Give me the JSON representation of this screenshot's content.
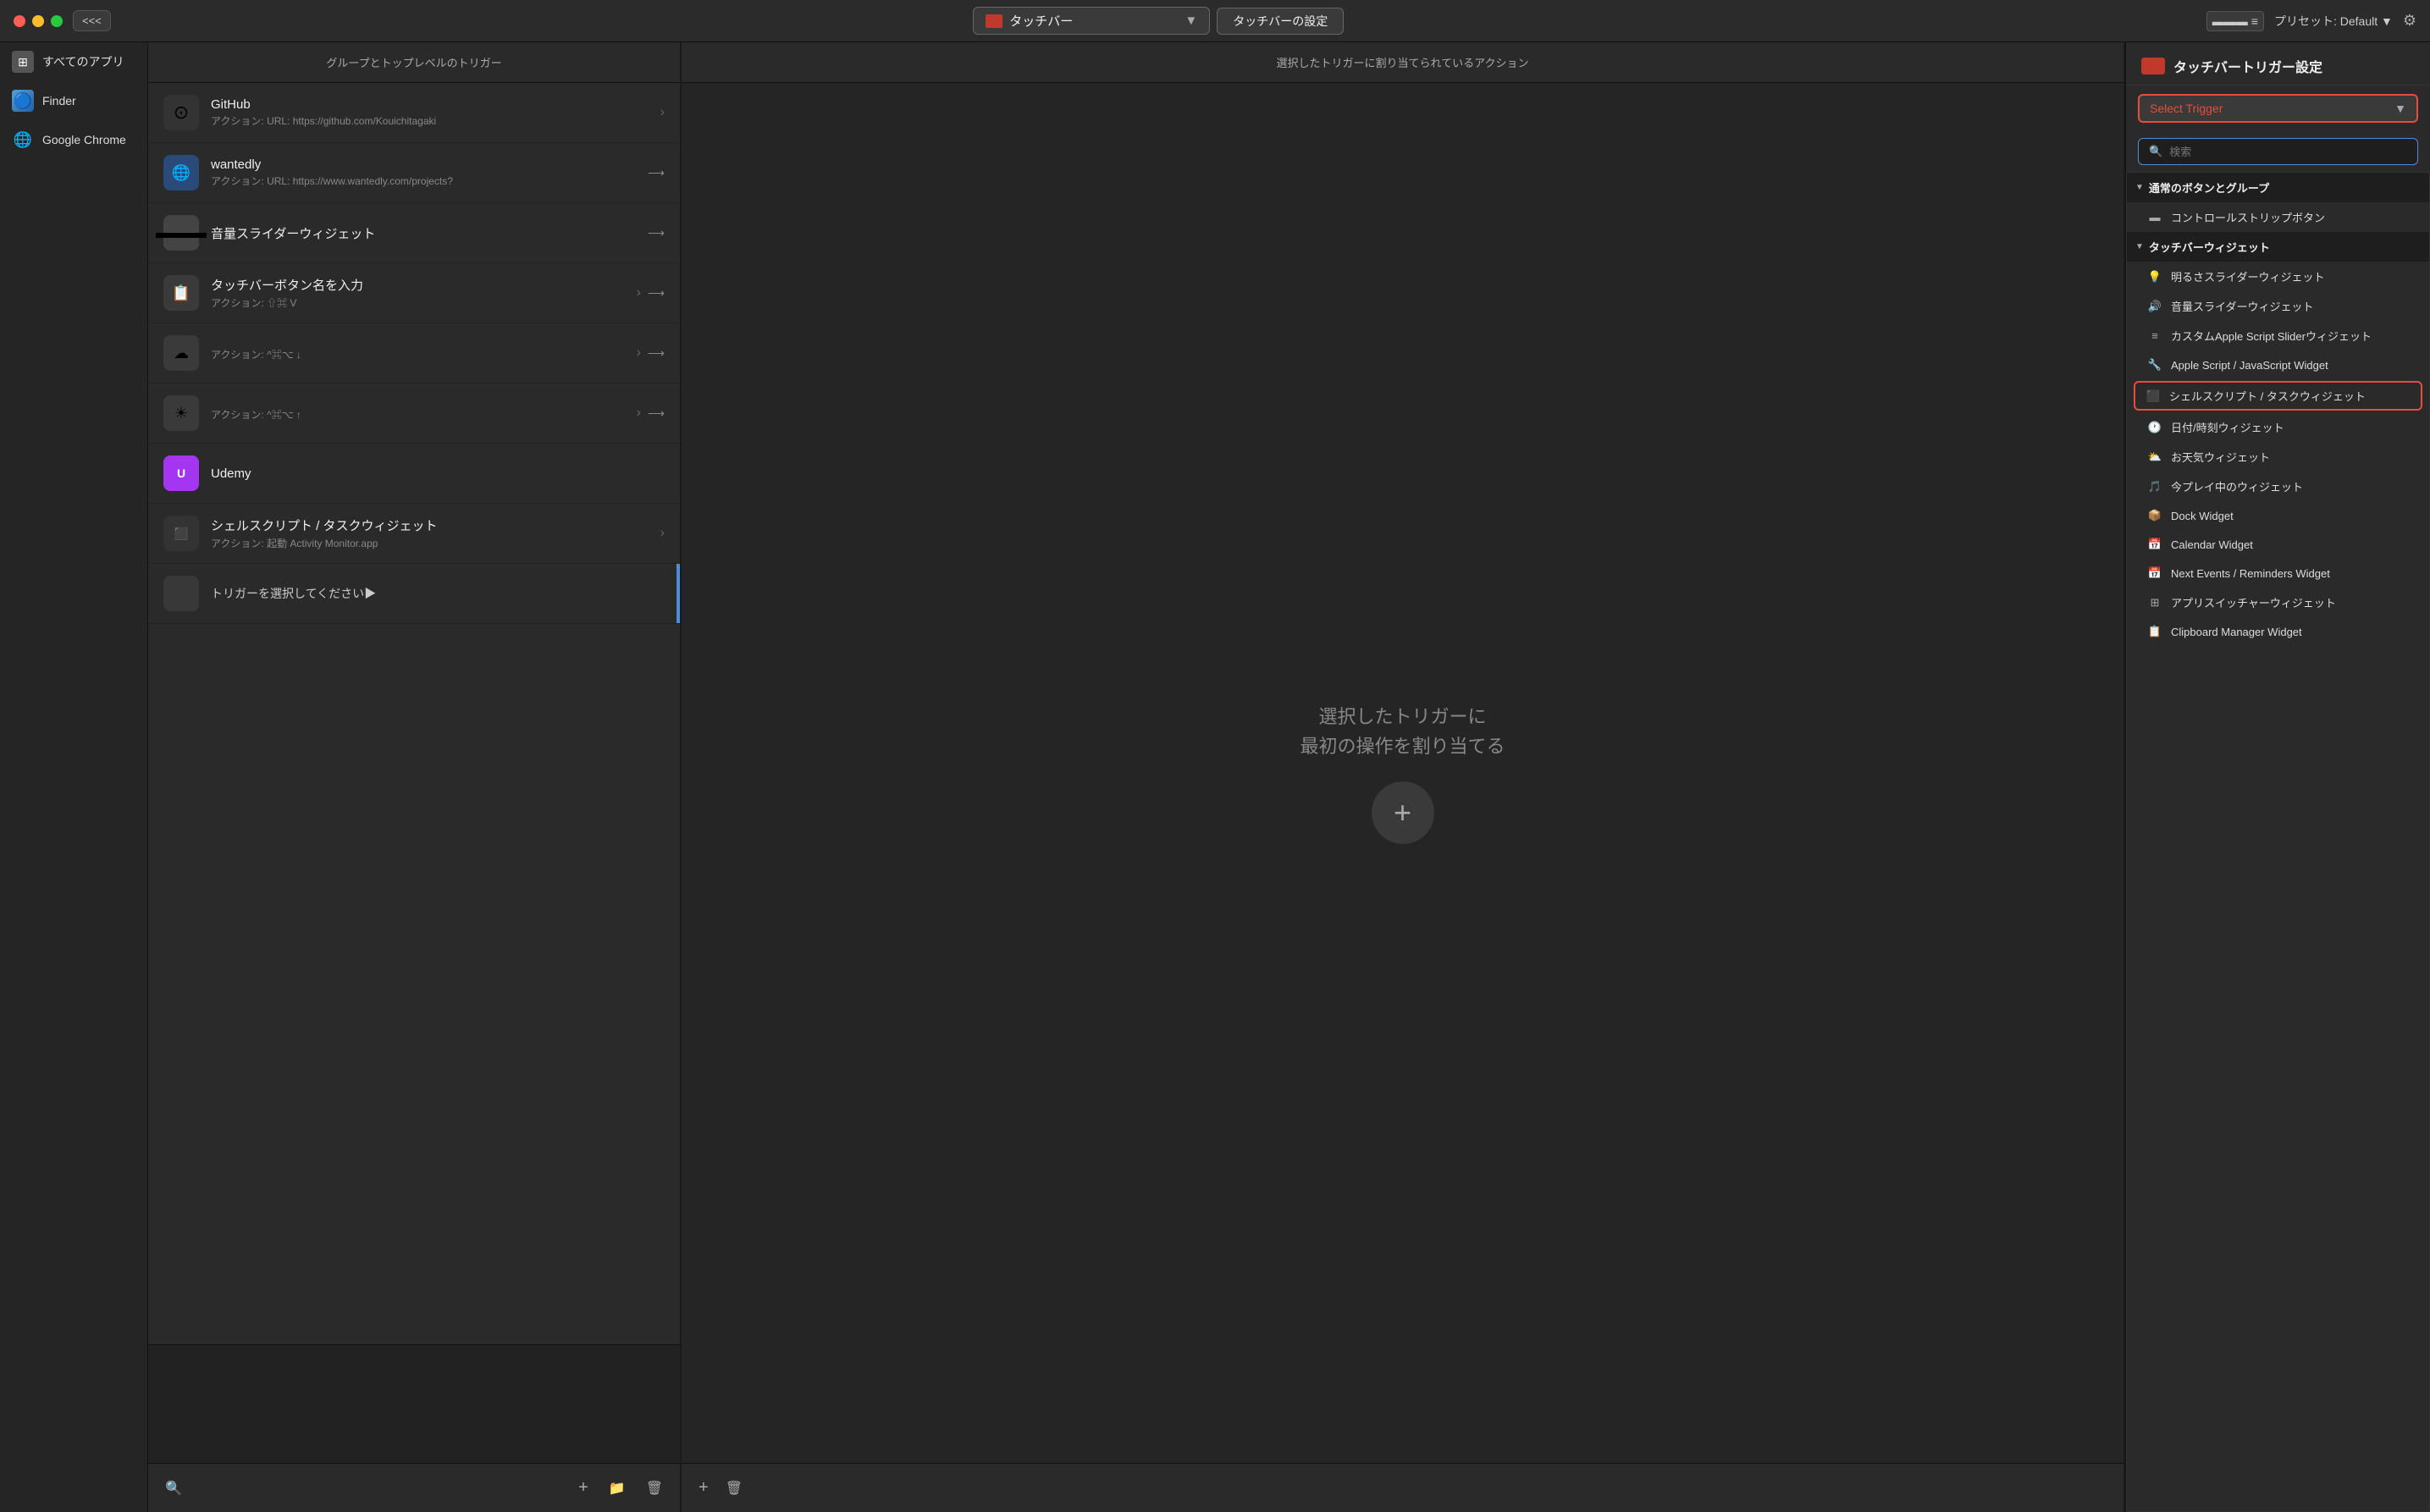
{
  "titlebar": {
    "nav_label": "<<<",
    "app_name": "タッチバー",
    "settings_btn": "タッチバーの設定",
    "preset_label": "プリセット: Default ▼"
  },
  "sidebar": {
    "items": [
      {
        "label": "すべてのアプリ",
        "icon": "🌐"
      },
      {
        "label": "Finder",
        "icon": "🔵"
      },
      {
        "label": "Google Chrome",
        "icon": "🌐"
      }
    ]
  },
  "trigger_panel": {
    "header": "グループとトップレベルのトリガー",
    "items": [
      {
        "name": "GitHub",
        "action": "アクション: URL: https://github.com/Kouichitagaki",
        "has_chevron": true,
        "icon_type": "circle"
      },
      {
        "name": "wantedly",
        "action": "アクション: URL: https://www.wantedly.com/projects?",
        "has_chevron": false,
        "icon_type": "globe"
      },
      {
        "name": "音量スライダーウィジェット",
        "action": "",
        "has_chevron": false,
        "icon_type": "gray"
      },
      {
        "name": "タッチバーボタン名を入力",
        "action": "アクション: ⇧⌘ V",
        "has_chevron": true,
        "icon_type": "clipboard"
      },
      {
        "name": "",
        "action": "アクション: ^⌘⌥ ↓",
        "has_chevron": true,
        "icon_type": "cloud"
      },
      {
        "name": "",
        "action": "アクション: ^⌘⌥ ↑",
        "has_chevron": true,
        "icon_type": "sun"
      },
      {
        "name": "Udemy",
        "action": "",
        "has_chevron": false,
        "icon_type": "udemy"
      },
      {
        "name": "シェルスクリプト / タスクウィジェット",
        "action": "アクション: 起動 Activity Monitor.app",
        "has_chevron": true,
        "icon_type": "terminal"
      },
      {
        "name": "トリガーを選択してください▶",
        "action": "",
        "has_chevron": false,
        "icon_type": "empty",
        "is_selected": true
      }
    ],
    "add_btn": "+",
    "footer_icons": [
      "search",
      "add",
      "folder",
      "trash"
    ]
  },
  "action_panel": {
    "header": "選択したトリガーに割り当てられているアクション",
    "empty_text_line1": "選択したトリガーに",
    "empty_text_line2": "最初の操作を割り当てる",
    "add_btn": "+",
    "footer_icons": [
      "add",
      "trash"
    ]
  },
  "settings_panel": {
    "title": "タッチバートリガー設定",
    "select_trigger_label": "Select Trigger",
    "search_placeholder": "検索",
    "categories": [
      {
        "name": "通常のボタンとグループ",
        "is_open": true,
        "items": [
          {
            "label": "コントロールストリップボタン",
            "icon": "▬"
          }
        ]
      },
      {
        "name": "タッチバーウィジェット",
        "is_open": true,
        "items": [
          {
            "label": "明るさスライダーウィジェット",
            "icon": "💡"
          },
          {
            "label": "音量スライダーウィジェット",
            "icon": "🔊"
          },
          {
            "label": "カスタムApple Script Sliderウィジェット",
            "icon": "≡"
          },
          {
            "label": "Apple Script / JavaScript Widget",
            "icon": "🔧"
          },
          {
            "label": "シェルスクリプト / タスクウィジェット",
            "icon": "⬛",
            "highlighted": true
          },
          {
            "label": "日付/時刻ウィジェット",
            "icon": "🕐"
          },
          {
            "label": "お天気ウィジェット",
            "icon": "⛅"
          },
          {
            "label": "今プレイ中のウィジェット",
            "icon": "🎵"
          },
          {
            "label": "Dock Widget",
            "icon": "📦"
          },
          {
            "label": "Calendar Widget",
            "icon": "📅"
          },
          {
            "label": "Next Events / Reminders Widget",
            "icon": "📅"
          },
          {
            "label": "アプリスイッチャーウィジェット",
            "icon": "⊞"
          },
          {
            "label": "Clipboard Manager Widget",
            "icon": "📋"
          }
        ]
      }
    ]
  }
}
